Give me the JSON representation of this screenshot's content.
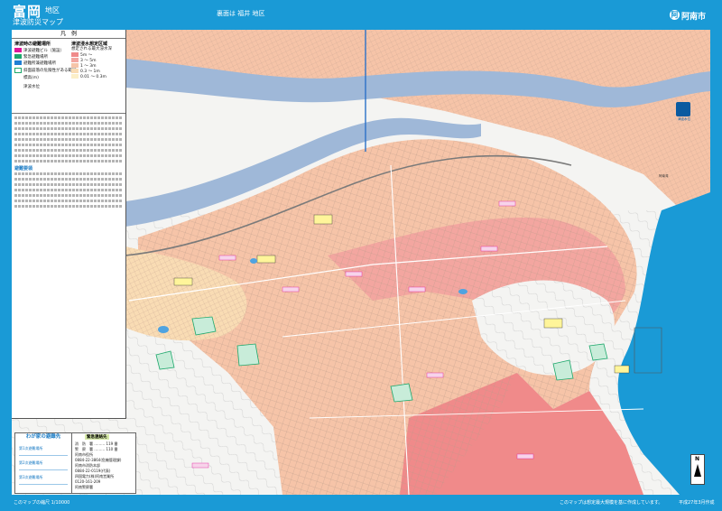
{
  "header": {
    "title_main": "富岡",
    "title_area": "地区",
    "title_sub": "津波防災マップ",
    "compare_note": "裏面は 福井 地区",
    "city_name": "阿南市",
    "city_logo": "阿"
  },
  "legend": {
    "title": "凡　例",
    "evac_head": "津波時の避難場所",
    "evac_items": [
      {
        "label": "津波避難ビル（施設）",
        "color": "#e0189a"
      },
      {
        "label": "緊急避難場所",
        "color": "#1ea86c"
      },
      {
        "label": "避難所兼避難場所",
        "color": "#1f7fd4"
      }
    ],
    "danger_label": "斜面崩落の危険性がある範囲",
    "elevation_label": "標高(m)",
    "marker_label": "津波水位",
    "depth_head": "津波浸水想定区域",
    "depth_sub": "想定される最大浸水深",
    "depth_items": [
      {
        "label": "5m ～",
        "color": "#f08a8a"
      },
      {
        "label": "3 ～ 5m",
        "color": "#f3a6a0"
      },
      {
        "label": "1 ～ 3m",
        "color": "#f6c4a8"
      },
      {
        "label": "0.3 ～ 1m",
        "color": "#f9dcb4"
      },
      {
        "label": "0.01 ～ 0.3m",
        "color": "#fcefc8"
      }
    ],
    "notes_head": "避難要領",
    "badge_text": "津波水位"
  },
  "my_evac": {
    "title": "わが家の避難先",
    "rows": [
      "第1次避難場所",
      "第2次避難場所",
      "第3次避難場所"
    ]
  },
  "contacts": {
    "head": "緊急連絡先",
    "items": [
      "消　防　署 ……… 119 番",
      "警　察　署 ……… 110 番",
      "阿南市役所",
      "0884-22-3864(危機管理課)",
      "阿南市消防本部",
      "0884-22-0119(代表)",
      "四国電力(株)阿南営業所",
      "0120-161-209",
      "阿南警察署",
      "0884-22-0110(代表)"
    ]
  },
  "map_labels": {
    "north": "N",
    "sea_label": "阿南湾"
  },
  "footer": {
    "left": "このマップの縮尺 1/10000",
    "right": "このマップは想定最大規模を基に作成しています。",
    "date": "平成27年3月作成"
  },
  "colors": {
    "frame": "#1a9ad6",
    "river": "#9fb8d8",
    "sea": "#1a9ad6",
    "land": "#f4f4f2",
    "flood_deep": "#f08a8a",
    "flood_mid": "#f6c4a8",
    "flood_shallow": "#fcefc8"
  }
}
